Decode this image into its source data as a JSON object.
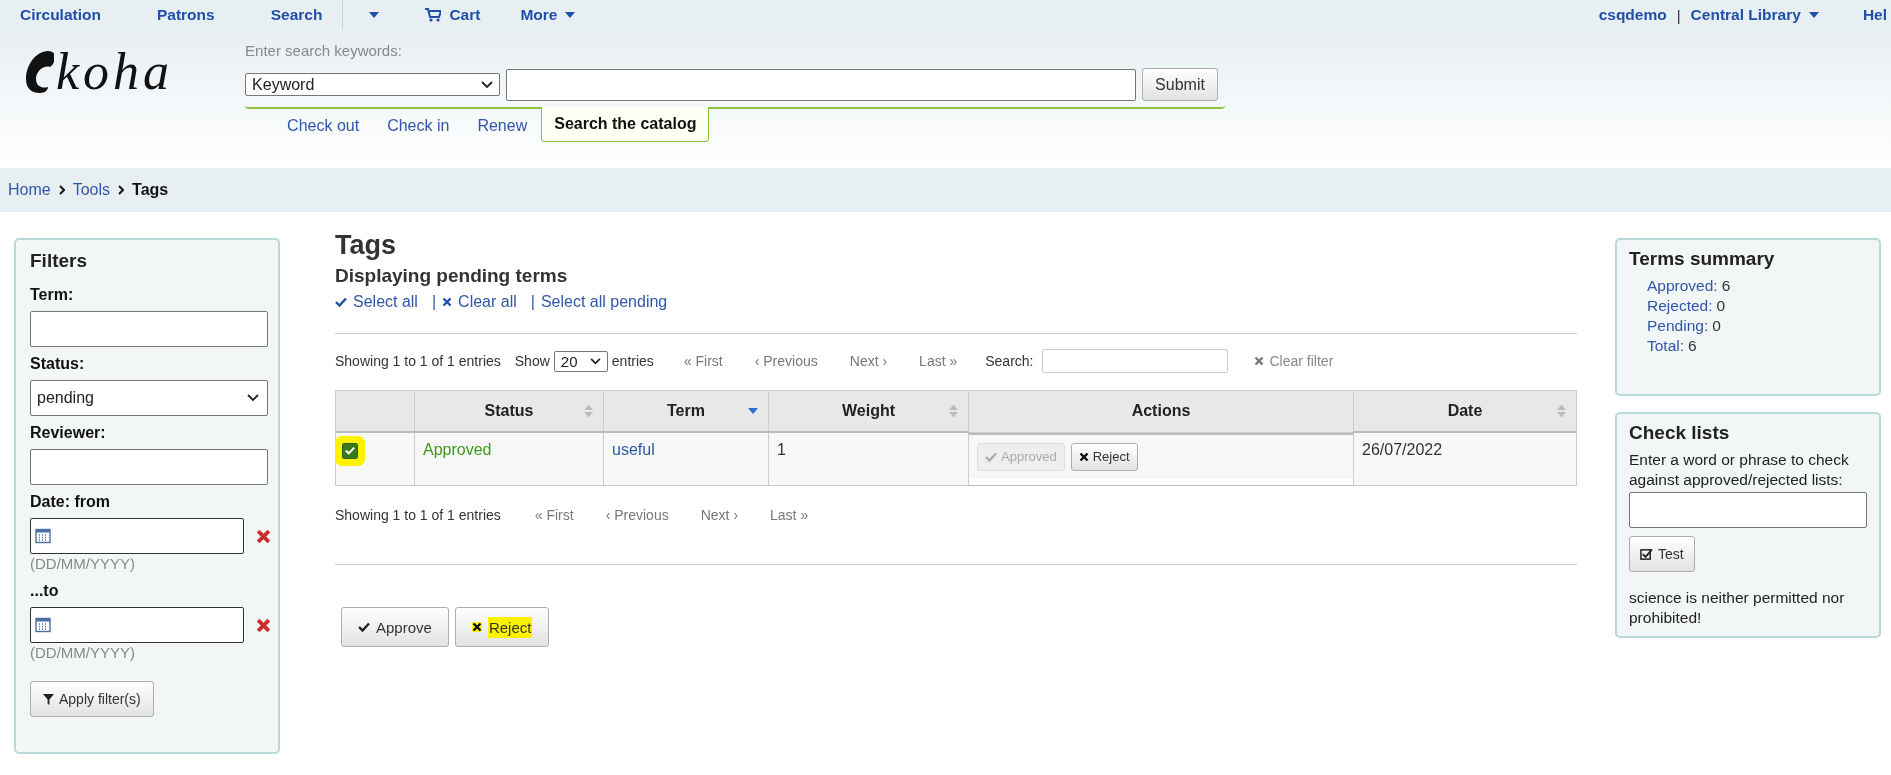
{
  "top_nav": {
    "left": [
      {
        "kind": "link",
        "label": "Circulation"
      },
      {
        "kind": "link",
        "label": "Patrons"
      },
      {
        "kind": "link",
        "label": "Search"
      },
      {
        "kind": "caret"
      },
      {
        "kind": "cart",
        "label": "Cart"
      },
      {
        "kind": "menu",
        "label": "More"
      }
    ],
    "logo": "koha",
    "user": "csqdemo",
    "separator": "|",
    "library": "Central Library",
    "help": "Hel"
  },
  "search": {
    "label": "Enter search keywords:",
    "type_value": "Keyword",
    "submit": "Submit",
    "tabs": [
      {
        "label": "Check out",
        "selected": false
      },
      {
        "label": "Check in",
        "selected": false
      },
      {
        "label": "Renew",
        "selected": false
      },
      {
        "label": "Search the catalog",
        "selected": true
      }
    ]
  },
  "breadcrumb": [
    {
      "label": "Home",
      "current": false
    },
    {
      "label": "Tools",
      "current": false
    },
    {
      "label": "Tags",
      "current": true
    }
  ],
  "filters": {
    "title": "Filters",
    "fields": [
      {
        "kind": "text",
        "label": "Term:"
      },
      {
        "kind": "select",
        "label": "Status:",
        "value": "pending"
      },
      {
        "kind": "text",
        "label": "Reviewer:"
      },
      {
        "kind": "date",
        "label": "Date: from",
        "hint": "(DD/MM/YYYY)"
      },
      {
        "kind": "date",
        "label": "...to",
        "hint": "(DD/MM/YYYY)"
      }
    ],
    "button": "Apply filter(s)"
  },
  "main": {
    "title": "Tags",
    "subtitle": "Displaying pending terms",
    "select_links": [
      {
        "kind": "select",
        "label": "Select all"
      },
      {
        "kind": "clear",
        "prefix": "|",
        "label": "Clear all"
      },
      {
        "kind": "pending",
        "prefix": "|",
        "label": "Select all pending"
      }
    ],
    "info_top": "Showing 1 to 1 of 1 entries",
    "show_label": "Show",
    "page_size": "20",
    "entries_label": "entries",
    "pager_top": [
      {
        "label": "« First",
        "disabled": true
      },
      {
        "label": "‹ Previous",
        "disabled": true
      },
      {
        "label": "Next ›",
        "disabled": true
      },
      {
        "label": "Last »",
        "disabled": true
      }
    ],
    "search_label": "Search:",
    "clear_filter": "Clear filter",
    "table": {
      "columns": [
        {
          "sortable": false,
          "sorted": false
        },
        {
          "label": "Status",
          "sortable": true,
          "sorted": false
        },
        {
          "label": "Term",
          "sortable": true,
          "sorted": true
        },
        {
          "label": "Weight",
          "sortable": true,
          "sorted": false
        },
        {
          "label": "Actions",
          "sortable": false,
          "sorted": false
        },
        {
          "label": "Date",
          "sortable": true,
          "sorted": false
        }
      ],
      "rows": [
        {
          "checked": true,
          "highlighted": true,
          "status": "Approved",
          "term": "useful",
          "weight": "1",
          "actions": [
            {
              "kind": "approve",
              "label": "Approved",
              "disabled": true
            },
            {
              "kind": "reject",
              "label": "Reject",
              "disabled": false
            }
          ],
          "date": "26/07/2022"
        }
      ]
    },
    "info_bottom": "Showing 1 to 1 of 1 entries",
    "pager_bottom": [
      {
        "label": "« First",
        "disabled": true
      },
      {
        "label": "‹ Previous",
        "disabled": true
      },
      {
        "label": "Next ›",
        "disabled": true
      },
      {
        "label": "Last »",
        "disabled": true
      }
    ],
    "buttons": [
      {
        "kind": "approve",
        "label": "Approve",
        "highlighted": false
      },
      {
        "kind": "reject",
        "label": "Reject",
        "highlighted": true
      }
    ]
  },
  "summary": {
    "title": "Terms summary",
    "items": [
      {
        "label": "Approved:",
        "value": "6"
      },
      {
        "label": "Rejected:",
        "value": "0"
      },
      {
        "label": "Pending:",
        "value": "0"
      },
      {
        "label": "Total:",
        "value": "6"
      }
    ]
  },
  "check_lists": {
    "title": "Check lists",
    "prompt": "Enter a word or phrase to check against approved/rejected lists:",
    "button": "Test",
    "result": "science is neither permitted nor prohibited!"
  }
}
